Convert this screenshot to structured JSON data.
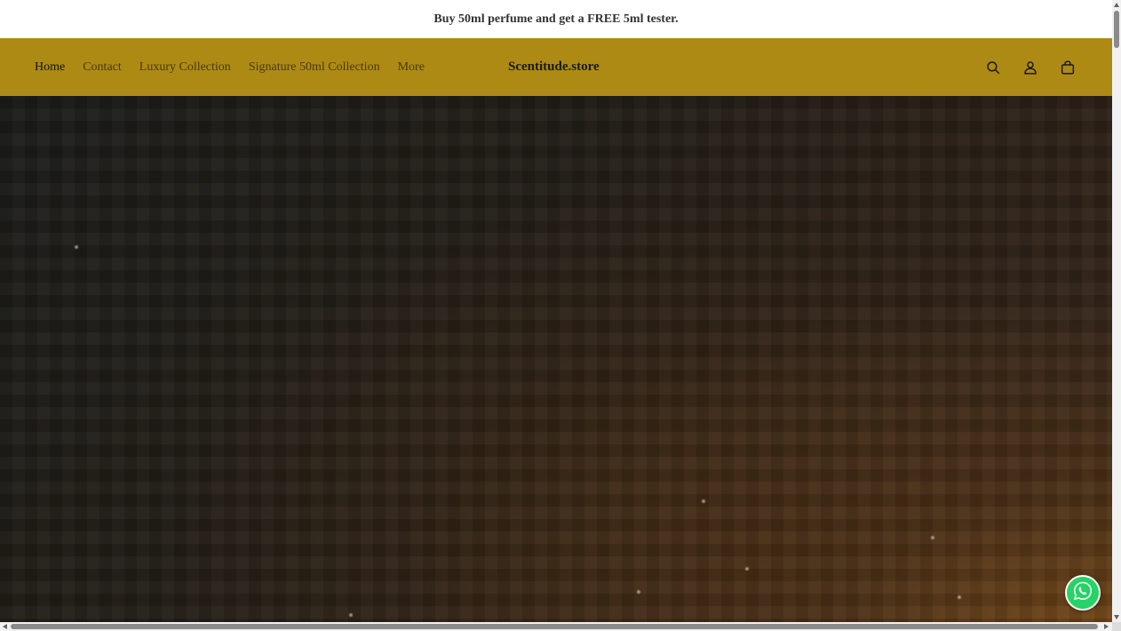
{
  "announcement": {
    "text": "Buy 50ml perfume and get a FREE 5ml tester."
  },
  "header": {
    "nav": [
      {
        "label": "Home",
        "active": true
      },
      {
        "label": "Contact",
        "active": false
      },
      {
        "label": "Luxury Collection",
        "active": false
      },
      {
        "label": "Signature 50ml Collection",
        "active": false
      },
      {
        "label": "More",
        "active": false
      }
    ],
    "logo": "Scentitude.store",
    "icons": [
      "search-icon",
      "account-icon",
      "cart-icon"
    ]
  },
  "floating": {
    "icon": "whatsapp-icon"
  },
  "colors": {
    "header_bg": "#ad8a14",
    "announcement_bg": "#ffffff",
    "hero_dark": "#1c1d19",
    "hero_warm": "#43301a",
    "whatsapp_green": "#25d366"
  }
}
